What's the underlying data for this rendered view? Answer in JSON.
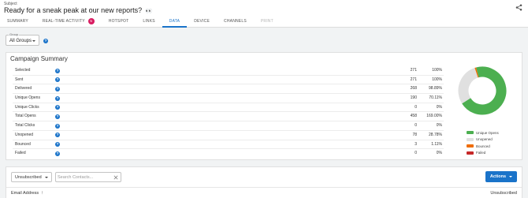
{
  "header": {
    "subject_label": "Subject",
    "subject_title": "Ready for a sneak peak at our new reports?",
    "subject_emoji": "👀",
    "share_icon": "share-icon"
  },
  "tabs": [
    {
      "label": "SUMMARY",
      "active": false
    },
    {
      "label": "REAL-TIME ACTIVITY",
      "badge": "5",
      "active": false
    },
    {
      "label": "HOTSPOT",
      "active": false
    },
    {
      "label": "LINKS",
      "active": false
    },
    {
      "label": "DATA",
      "active": true
    },
    {
      "label": "DEVICE",
      "active": false
    },
    {
      "label": "CHANNELS",
      "active": false
    },
    {
      "label": "PRINT",
      "active": false,
      "disabled": true
    }
  ],
  "group_filter": {
    "label": "Group",
    "value": "All Groups",
    "help": "?"
  },
  "campaign_summary": {
    "title": "Campaign Summary",
    "rows": [
      {
        "label": "Selected",
        "count": "271",
        "pct": "100%"
      },
      {
        "label": "Sent",
        "count": "271",
        "pct": "100%"
      },
      {
        "label": "Delivered",
        "count": "268",
        "pct": "98.89%"
      },
      {
        "label": "Unique Opens",
        "count": "190",
        "pct": "70.11%"
      },
      {
        "label": "Unique Clicks",
        "count": "0",
        "pct": "0%"
      },
      {
        "label": "Total Opens",
        "count": "458",
        "pct": "169.00%"
      },
      {
        "label": "Total Clicks",
        "count": "0",
        "pct": "0%"
      },
      {
        "label": "Unopened",
        "count": "78",
        "pct": "28.78%"
      },
      {
        "label": "Bounced",
        "count": "3",
        "pct": "1.11%"
      },
      {
        "label": "Failed",
        "count": "0",
        "pct": "0%"
      }
    ]
  },
  "chart_data": {
    "type": "pie",
    "donut": true,
    "categories": [
      "Unique Opens",
      "Unopened",
      "Bounced",
      "Failed"
    ],
    "values": [
      190,
      78,
      3,
      0
    ],
    "colors": [
      "#4caf50",
      "#e0e0e0",
      "#ef6c00",
      "#c62828"
    ],
    "legend_position": "bottom"
  },
  "contacts": {
    "filter_value": "Unsubscribed",
    "search_placeholder": "Search Contacts...",
    "actions_label": "Actions",
    "col_email": "Email Address",
    "col_unsubscribed": "Unsubscribed"
  }
}
